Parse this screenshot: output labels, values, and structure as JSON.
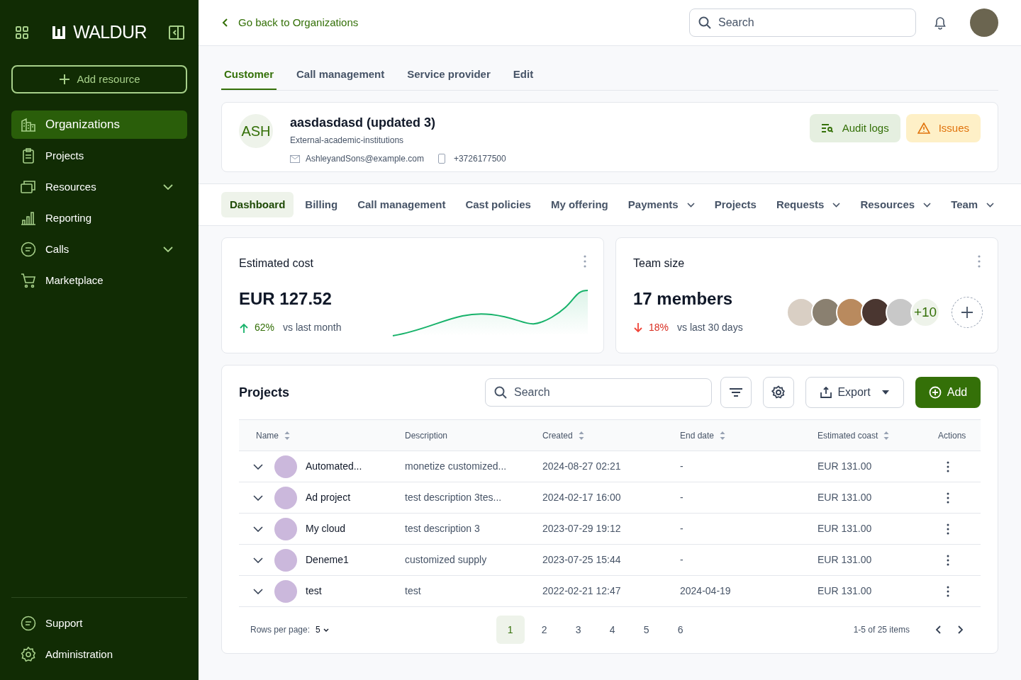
{
  "sidebar": {
    "brand": "WALDUR",
    "add_button": "Add resource",
    "items": [
      {
        "label": "Organizations",
        "selected": true,
        "has_submenu": false
      },
      {
        "label": "Projects",
        "selected": false,
        "has_submenu": false
      },
      {
        "label": "Resources",
        "selected": false,
        "has_submenu": true
      },
      {
        "label": "Reporting",
        "selected": false,
        "has_submenu": false
      },
      {
        "label": "Calls",
        "selected": false,
        "has_submenu": true
      },
      {
        "label": "Marketplace",
        "selected": false,
        "has_submenu": false
      }
    ],
    "footer_items": [
      {
        "label": "Support"
      },
      {
        "label": "Administration"
      }
    ]
  },
  "header": {
    "back_link": "Go back to Organizations",
    "search": {
      "placeholder": "Search"
    }
  },
  "customer_tabs": [
    {
      "label": "Customer",
      "selected": true
    },
    {
      "label": "Call management",
      "selected": false
    },
    {
      "label": "Service provider",
      "selected": false
    },
    {
      "label": "Edit",
      "selected": false
    }
  ],
  "customer": {
    "initials": "ASH",
    "name": "aasdasdasd (updated 3)",
    "category": "External-academic-institutions",
    "email": "AshleyandSons@example.com",
    "phone": "+3726177500",
    "buttons": [
      {
        "label": "Audit logs",
        "kind": "audit"
      },
      {
        "label": "Issues",
        "kind": "warning"
      }
    ]
  },
  "section_tabs": [
    {
      "label": "Dashboard",
      "selected": true,
      "has_dropdown": false
    },
    {
      "label": "Billing",
      "selected": false,
      "has_dropdown": false
    },
    {
      "label": "Call management",
      "selected": false,
      "has_dropdown": false
    },
    {
      "label": "Cast policies",
      "selected": false,
      "has_dropdown": false
    },
    {
      "label": "My offering",
      "selected": false,
      "has_dropdown": false
    },
    {
      "label": "Payments",
      "selected": false,
      "has_dropdown": true
    },
    {
      "label": "Projects",
      "selected": false,
      "has_dropdown": false
    },
    {
      "label": "Requests",
      "selected": false,
      "has_dropdown": true
    },
    {
      "label": "Resources",
      "selected": false,
      "has_dropdown": true
    },
    {
      "label": "Team",
      "selected": false,
      "has_dropdown": true
    }
  ],
  "cost_card": {
    "title": "Estimated cost",
    "value": "EUR 127.52",
    "change": {
      "kind": "increase",
      "percent": "62%",
      "text": "vs last month"
    }
  },
  "team_card": {
    "title": "Team size",
    "value": "17 members",
    "change": {
      "kind": "decrease",
      "percent": "18%",
      "text": "vs last 30 days"
    },
    "more_count": "+10"
  },
  "projects": {
    "title": "Projects",
    "search": {
      "placeholder": "Search"
    },
    "export_button": "Export",
    "add_button": "Add",
    "columns": [
      {
        "label": "Name",
        "sortable": true
      },
      {
        "label": "Description",
        "sortable": false
      },
      {
        "label": "Created",
        "sortable": true
      },
      {
        "label": "End date",
        "sortable": true
      },
      {
        "label": "Estimated coast",
        "sortable": true
      },
      {
        "label": "Actions",
        "sortable": false
      }
    ],
    "rows": [
      {
        "name": "Automated...",
        "description": "monetize customized...",
        "created": "2024-08-27 02:21",
        "end_date": "-",
        "cost": "EUR 131.00"
      },
      {
        "name": "Ad project",
        "description": "test description 3tes...",
        "created": "2024-02-17 16:00",
        "end_date": "-",
        "cost": "EUR 131.00"
      },
      {
        "name": "My cloud",
        "description": "test description 3",
        "created": "2023-07-29 19:12",
        "end_date": "-",
        "cost": "EUR 131.00"
      },
      {
        "name": "Deneme1",
        "description": "customized supply",
        "created": "2023-07-25 15:44",
        "end_date": "-",
        "cost": "EUR 131.00"
      },
      {
        "name": "test",
        "description": "test",
        "created": "2022-02-21 12:47",
        "end_date": "2024-04-19",
        "cost": "EUR 131.00"
      }
    ],
    "pagination": {
      "rows_per_page_label": "Rows per page:",
      "rows_per_page": "5",
      "pages": [
        {
          "label": "1",
          "selected": true
        },
        {
          "label": "2",
          "selected": false
        },
        {
          "label": "3",
          "selected": false
        },
        {
          "label": "4",
          "selected": false
        },
        {
          "label": "5",
          "selected": false
        },
        {
          "label": "6",
          "selected": false
        }
      ],
      "range": "1-5 of 25 items"
    }
  }
}
